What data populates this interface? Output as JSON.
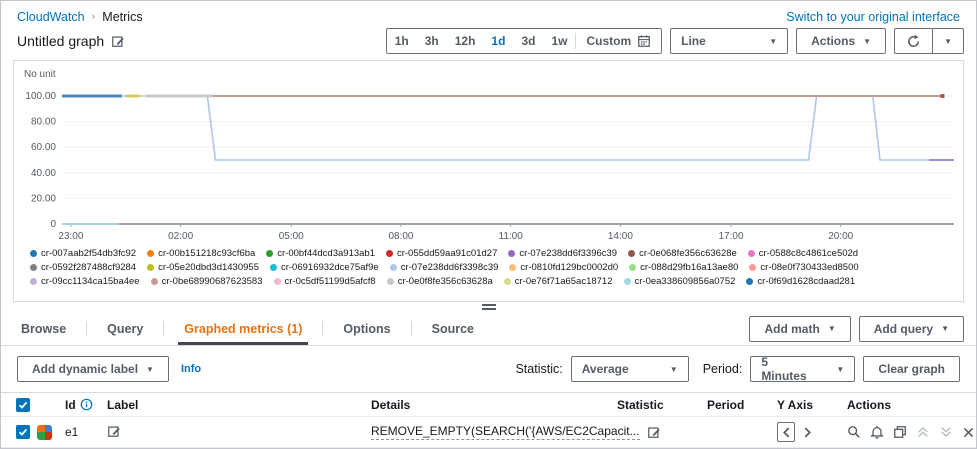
{
  "breadcrumb": {
    "items": [
      "CloudWatch",
      "Metrics"
    ]
  },
  "header": {
    "title": "Untitled graph",
    "switch_link": "Switch to your original interface"
  },
  "toolbar": {
    "ranges": [
      "1h",
      "3h",
      "12h",
      "1d",
      "3d",
      "1w"
    ],
    "active_range": "1d",
    "custom_label": "Custom",
    "line_select": "Line",
    "actions_label": "Actions"
  },
  "chart_data": {
    "type": "line",
    "ylabel": "No unit",
    "ylim": [
      0,
      113
    ],
    "yticks": [
      {
        "v": 100,
        "label": "100.00"
      },
      {
        "v": 80,
        "label": "80.00"
      },
      {
        "v": 60,
        "label": "60.00"
      },
      {
        "v": 40,
        "label": "40.00"
      },
      {
        "v": 20,
        "label": "20.00"
      },
      {
        "v": 0,
        "label": "0"
      }
    ],
    "xticks": [
      {
        "label": "23:00",
        "pos": 0.01
      },
      {
        "label": "02:00",
        "pos": 0.133
      },
      {
        "label": "05:00",
        "pos": 0.257
      },
      {
        "label": "08:00",
        "pos": 0.38
      },
      {
        "label": "11:00",
        "pos": 0.503
      },
      {
        "label": "14:00",
        "pos": 0.626
      },
      {
        "label": "17:00",
        "pos": 0.75
      },
      {
        "label": "20:00",
        "pos": 0.873
      }
    ],
    "series": [
      {
        "name": "line-lightblue-step",
        "color": "#aec7e8",
        "width": 1.6,
        "points": [
          [
            0,
            100
          ],
          [
            0.163,
            100
          ],
          [
            0.172,
            50
          ],
          [
            0.837,
            50
          ],
          [
            0.846,
            100
          ],
          [
            0.909,
            100
          ],
          [
            0.917,
            50
          ],
          [
            1,
            50
          ]
        ]
      },
      {
        "name": "line-zero",
        "color": "#a8d3e8",
        "width": 2,
        "points": [
          [
            0,
            0
          ],
          [
            0.064,
            0
          ]
        ]
      },
      {
        "name": "line-brown-100",
        "color": "#c49c94",
        "width": 2,
        "points": [
          [
            0.168,
            100
          ],
          [
            0.987,
            100
          ]
        ],
        "end_marker": true,
        "marker_color": "#b0564a"
      },
      {
        "name": "segment-purple-end",
        "color": "#9b8fd4",
        "width": 2,
        "points": [
          [
            0.972,
            50
          ],
          [
            1,
            50
          ]
        ]
      },
      {
        "name": "segment-blue-100",
        "color": "#4f81ba",
        "width": 3,
        "points": [
          [
            0,
            100
          ],
          [
            0.067,
            100
          ]
        ]
      },
      {
        "name": "segment-yellow-100",
        "color": "#d9ca60",
        "width": 3,
        "points": [
          [
            0.072,
            100
          ],
          [
            0.088,
            100
          ]
        ]
      },
      {
        "name": "segment-gray-100",
        "color": "#c9c9c9",
        "width": 3,
        "points": [
          [
            0.094,
            100
          ],
          [
            0.168,
            100
          ]
        ]
      }
    ],
    "legend": [
      {
        "label": "cr-007aab2f54db3fc92",
        "color": "#1f77b4"
      },
      {
        "label": "cr-00b151218c93cf6ba",
        "color": "#ff7f0e"
      },
      {
        "label": "cr-00bf44dcd3a913ab1",
        "color": "#2ca02c"
      },
      {
        "label": "cr-055dd59aa91c01d27",
        "color": "#d62728"
      },
      {
        "label": "cr-07e238dd6f3396c39",
        "color": "#9467bd"
      },
      {
        "label": "cr-0e068fe356c63628e",
        "color": "#8c564b"
      },
      {
        "label": "cr-0588c8c4861ce502d",
        "color": "#e377c2"
      },
      {
        "label": "cr-0592f287488cf9284",
        "color": "#7f7f7f"
      },
      {
        "label": "cr-05e20dbd3d1430955",
        "color": "#bcbd22"
      },
      {
        "label": "cr-06916932dce75af9e",
        "color": "#17becf"
      },
      {
        "label": "cr-07e238dd6f3398c39",
        "color": "#aec7e8"
      },
      {
        "label": "cr-0810fd129bc0002d0",
        "color": "#ffbb78"
      },
      {
        "label": "cr-088d29fb16a13ae80",
        "color": "#98df8a"
      },
      {
        "label": "cr-08e0f730433ed8500",
        "color": "#ff9896"
      },
      {
        "label": "cr-09cc1134ca15ba4ee",
        "color": "#c5b0d5"
      },
      {
        "label": "cr-0be68990687623583",
        "color": "#c49c94"
      },
      {
        "label": "cr-0c5df51199d5afcf8",
        "color": "#f7b6d2"
      },
      {
        "label": "cr-0e0f8fe356c63628a",
        "color": "#c7c7c7"
      },
      {
        "label": "cr-0e76f71a65ac18712",
        "color": "#dbdb8d"
      },
      {
        "label": "cr-0ea338609856a0752",
        "color": "#9edae5"
      },
      {
        "label": "cr-0f69d1628cdaad281",
        "color": "#1f77b4"
      }
    ]
  },
  "tabs": {
    "items": [
      "Browse",
      "Query",
      "Graphed metrics (1)",
      "Options",
      "Source"
    ],
    "active": "Graphed metrics (1)",
    "add_math": "Add math",
    "add_query": "Add query"
  },
  "controls": {
    "add_dynamic_label": "Add dynamic label",
    "info": "Info",
    "statistic_label": "Statistic:",
    "statistic_value": "Average",
    "period_label": "Period:",
    "period_value": "5 Minutes",
    "clear_graph": "Clear graph"
  },
  "table": {
    "columns": {
      "id": "Id",
      "label": "Label",
      "details": "Details",
      "statistic": "Statistic",
      "period": "Period",
      "y_axis": "Y Axis",
      "actions": "Actions"
    },
    "rows": [
      {
        "selected": true,
        "id": "e1",
        "label": "",
        "details": "REMOVE_EMPTY(SEARCH('{AWS/EC2Capacit...",
        "statistic": "",
        "period": "",
        "swatch_colors": [
          "#ec7211",
          "#3b7dd8",
          "#2ea043",
          "#d13212"
        ]
      }
    ]
  }
}
